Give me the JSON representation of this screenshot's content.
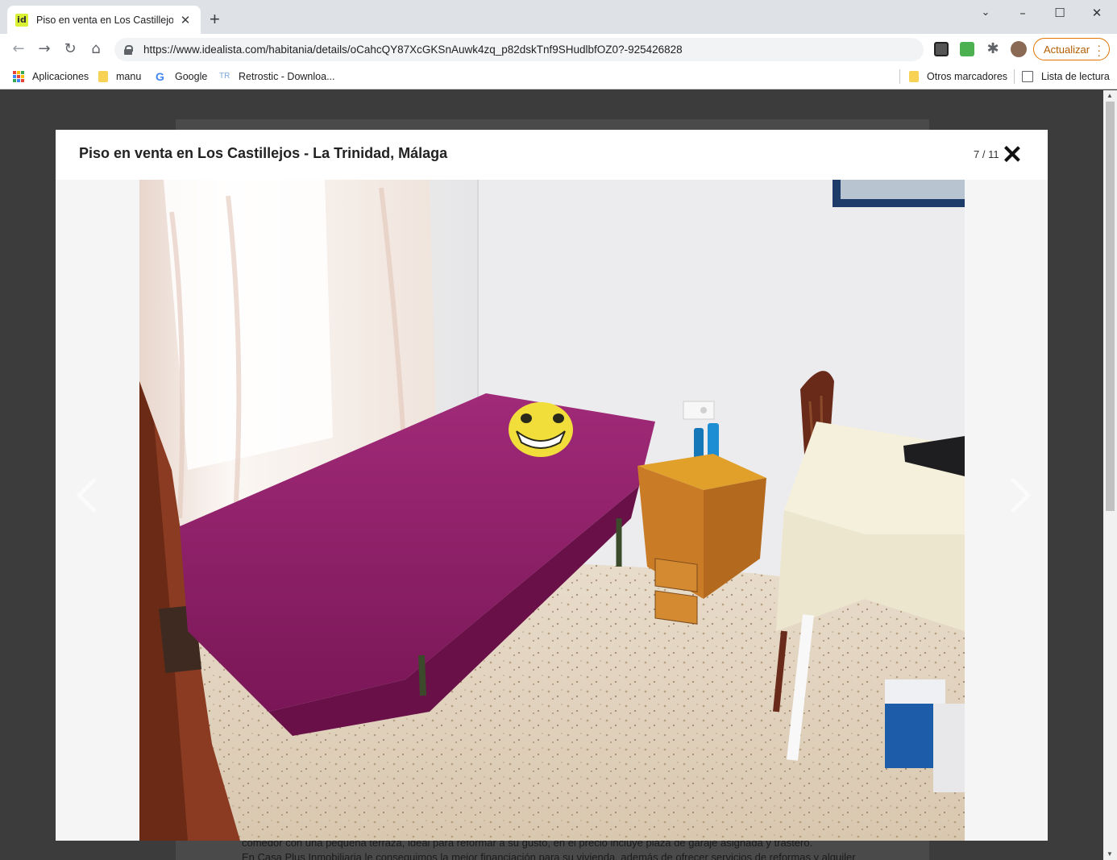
{
  "browser": {
    "tab_title": "Piso en venta en Los Castillejos - ",
    "favicon_text": "id",
    "url": "https://www.idealista.com/habitania/details/oCahcQY87XcGKSnAuwk4zq_p82dskTnf9SHudlbfOZ0?-925426828",
    "update_label": "Actualizar",
    "bookmarks": {
      "apps": "Aplicaciones",
      "manu": "manu",
      "google": "Google",
      "retrostic": "Retrostic - Downloa...",
      "other": "Otros marcadores",
      "reading_list": "Lista de lectura"
    },
    "icons": {
      "back": "back-arrow-icon",
      "forward": "forward-arrow-icon",
      "reload": "reload-icon",
      "home": "home-icon",
      "extensions": "puzzle-icon",
      "menu": "kebab-menu-icon"
    },
    "accent_color": "#e37400"
  },
  "page": {
    "text_line_1": "comedor con una pequeña terraza, ideal para reformar a su gusto, en el precio incluye plaza de garaje asignada y trastero.",
    "text_line_2": "En Casa Plus Inmobiliaria le conseguimos la mejor financiación para su vivienda, además de ofrecer servicios de reformas y alquiler"
  },
  "gallery": {
    "title": "Piso en venta en Los Castillejos - La Trinidad, Málaga",
    "counter": "7 / 11",
    "photo_alt": "Dormitorio con cama individual, colcha morada, cojín emoji, mesita de noche y silla",
    "close_icon": "close-x-icon",
    "prev_icon": "chevron-left-icon",
    "next_icon": "chevron-right-icon"
  }
}
